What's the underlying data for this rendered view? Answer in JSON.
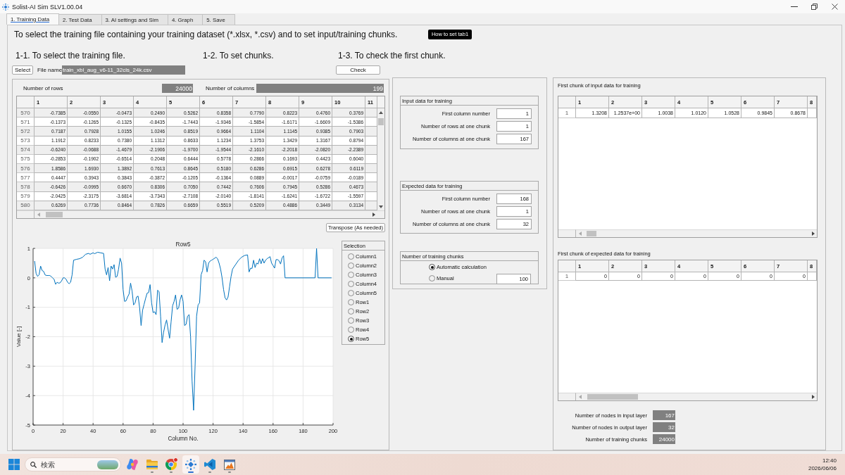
{
  "window": {
    "title": "Solist-AI Sim SLV1.00.04"
  },
  "tabs": [
    {
      "label": "1. Training Data",
      "selected": true
    },
    {
      "label": "2. Test Data",
      "selected": false
    },
    {
      "label": "3. AI settings and Sim",
      "selected": false
    },
    {
      "label": "4. Graph",
      "selected": false
    },
    {
      "label": "5. Save",
      "selected": false
    }
  ],
  "page": {
    "instruction": "To select the training file containing your training dataset (*.xlsx, *.csv) and to set input/training chunks.",
    "help_button": "How to set tab1",
    "section_headings": [
      "1-1. To select the training file.",
      "1-2. To set chunks.",
      "1-3. To check the first chunk."
    ],
    "select_button": "Select",
    "file_label": "File name",
    "file_name": "train_xbl_aug_v6-11_32cls_24k.csv",
    "check_button": "Check"
  },
  "data_panel": {
    "counts": [
      {
        "label": "Number of rows",
        "value": "24000"
      },
      {
        "label": "Number of columns",
        "value": "199"
      }
    ],
    "table": {
      "columns": [
        "1",
        "2",
        "3",
        "4",
        "5",
        "6",
        "7",
        "8",
        "9",
        "10",
        "11"
      ],
      "rows": [
        {
          "header": "570",
          "cells": [
            "-0.7385",
            "-0.0550",
            "-0.0473",
            "0.2490",
            "0.5262",
            "0.8358",
            "0.7790",
            "0.8223",
            "0.4760",
            "0.3769"
          ]
        },
        {
          "header": "571",
          "cells": [
            "-0.1373",
            "-0.1265",
            "-0.1325",
            "-0.8435",
            "-1.7443",
            "-1.9346",
            "-1.5854",
            "-1.6171",
            "-1.6609",
            "-1.5386"
          ]
        },
        {
          "header": "572",
          "cells": [
            "0.7187",
            "0.7928",
            "1.0155",
            "1.0246",
            "0.8519",
            "0.9664",
            "1.1104",
            "1.1145",
            "0.9385",
            "0.7903"
          ]
        },
        {
          "header": "573",
          "cells": [
            "1.1912",
            "0.8233",
            "0.7380",
            "1.1312",
            "0.8633",
            "1.1234",
            "1.3753",
            "1.3429",
            "1.3167",
            "0.8794"
          ]
        },
        {
          "header": "574",
          "cells": [
            "-0.6240",
            "-0.0688",
            "-1.4679",
            "-2.1906",
            "-1.9700",
            "-1.9544",
            "-2.1610",
            "-2.2018",
            "-2.0820",
            "-2.2389"
          ]
        },
        {
          "header": "575",
          "cells": [
            "-0.2853",
            "-0.1902",
            "-0.6514",
            "0.2048",
            "0.6444",
            "0.5778",
            "0.2866",
            "0.1693",
            "0.4423",
            "0.6040"
          ]
        },
        {
          "header": "576",
          "cells": [
            "1.8586",
            "1.6930",
            "1.3892",
            "0.7613",
            "0.8645",
            "0.5180",
            "0.6286",
            "0.6915",
            "0.6278",
            "0.6119"
          ]
        },
        {
          "header": "577",
          "cells": [
            "0.4447",
            "0.3943",
            "0.3843",
            "-0.3872",
            "-0.1205",
            "-0.1364",
            "0.0889",
            "-0.0017",
            "-0.0759",
            "-0.0189"
          ]
        },
        {
          "header": "578",
          "cells": [
            "-0.6426",
            "-0.0995",
            "0.6670",
            "0.8306",
            "0.7050",
            "0.7442",
            "0.7606",
            "0.7945",
            "0.5286",
            "0.4673"
          ]
        },
        {
          "header": "579",
          "cells": [
            "-2.0425",
            "-2.3175",
            "-3.6814",
            "-3.7343",
            "-2.7108",
            "-2.0140",
            "-1.8141",
            "-1.6241",
            "-1.6722",
            "-1.5597"
          ]
        },
        {
          "header": "580",
          "cells": [
            "0.6269",
            "0.7736",
            "0.8464",
            "0.7826",
            "0.6659",
            "0.5519",
            "0.5209",
            "0.4886",
            "0.3449",
            "0.3134"
          ]
        }
      ]
    },
    "transpose_button": "Transpose (As needed)",
    "chart_data": [
      {
        "type": "line",
        "title": "Row5",
        "xlabel": "Column No.",
        "ylabel": "Value [-]",
        "color": "#0072bd",
        "grid": true,
        "xlim": [
          0,
          200
        ],
        "ylim": [
          -5,
          1
        ],
        "xticks": [
          0,
          20,
          40,
          60,
          80,
          100,
          120,
          140,
          160,
          180,
          200
        ],
        "yticks": [
          -5,
          -4,
          -3,
          -2,
          -1,
          0,
          1
        ],
        "x": [
          1,
          2,
          3,
          4,
          5,
          6,
          7,
          8,
          9,
          10,
          11,
          12,
          13,
          14,
          15,
          16,
          17,
          18,
          19,
          20,
          21,
          22,
          23,
          24,
          25,
          26,
          27,
          29,
          31,
          33,
          35,
          37,
          38,
          40,
          41,
          43,
          45,
          47,
          48,
          49,
          50,
          51,
          52,
          53,
          54,
          55,
          56,
          57,
          58,
          59,
          60,
          61,
          62,
          63,
          64,
          65,
          66,
          67,
          68,
          69,
          70,
          71,
          72,
          73,
          74,
          75,
          76,
          77,
          78,
          79,
          80,
          81,
          82,
          83,
          84,
          85,
          86,
          87,
          88,
          89,
          90,
          91,
          92,
          93,
          94,
          95,
          96,
          97,
          98,
          99,
          100,
          101,
          102,
          103,
          104,
          105,
          106,
          107,
          108,
          109,
          110,
          111,
          112,
          113,
          114,
          115,
          116,
          117,
          118,
          119,
          120,
          122,
          123,
          124,
          125,
          126,
          127,
          128,
          129,
          130,
          131,
          132,
          133,
          135,
          137,
          139,
          141,
          143,
          144,
          145,
          146,
          147,
          148,
          149,
          150,
          151,
          152,
          153,
          154,
          155,
          156,
          158,
          159,
          160,
          161,
          162,
          163,
          164,
          165,
          166,
          167,
          168,
          188,
          189,
          190,
          199
        ],
        "values": [
          0.57,
          0.15,
          0.05,
          0.1,
          0.4,
          0.25,
          0.22,
          0.1,
          0.08,
          0.08,
          0.08,
          0.05,
          0,
          -0.05,
          -0.22,
          -0.15,
          -0.18,
          -0.17,
          -0.1,
          0,
          0,
          -0.05,
          -0.15,
          -0.2,
          -0.15,
          0.1,
          0.6,
          0.63,
          0.65,
          0.7,
          0.8,
          0.83,
          0.8,
          0.85,
          0.82,
          0.87,
          0.85,
          0.83,
          0.3,
          0.1,
          0.35,
          -0.1,
          0.4,
          0.3,
          0.45,
          0.02,
          0.05,
          0.3,
          0.67,
          0.5,
          -0.4,
          -0.8,
          -0.78,
          -0.65,
          -0.55,
          -0.18,
          -0.45,
          -0.92,
          -0.85,
          -0.65,
          -0.62,
          -1,
          -1.62,
          -1.1,
          -0.9,
          -0.7,
          -0.52,
          -0.5,
          -0.23,
          -0.85,
          -1.18,
          -1.15,
          -1.25,
          -0.42,
          -0.47,
          -1.3,
          -2.2,
          -1.85,
          -1.6,
          -1.43,
          -1.75,
          -2.05,
          -1.5,
          -0.95,
          -0.8,
          -0.58,
          -1.07,
          -1.03,
          -0.75,
          -0.58,
          -0.8,
          -1.62,
          -1.58,
          -1.3,
          -1.25,
          -2,
          -3.5,
          -4.5,
          -3,
          -1.3,
          -0.92,
          -0.85,
          0.1,
          0.25,
          0.6,
          0.55,
          0.2,
          0.5,
          0.57,
          0.6,
          0.63,
          0.7,
          0.65,
          0.5,
          0.3,
          0,
          -0.4,
          -0.68,
          -0.75,
          -0.65,
          -0.3,
          0.05,
          0.3,
          0.45,
          0.6,
          0.7,
          0.76,
          0.78,
          0.2,
          0.33,
          0.32,
          0.6,
          0.35,
          0.5,
          0.47,
          0.65,
          0.48,
          0.65,
          0.5,
          0.6,
          0.65,
          0.72,
          0.5,
          0.42,
          0.33,
          0.62,
          0.62,
          0.58,
          0.47,
          0.68,
          0.75,
          0,
          0,
          1,
          0,
          0
        ]
      }
    ],
    "selection": {
      "title": "Selection",
      "options": [
        {
          "label": "Column1",
          "selected": false
        },
        {
          "label": "Column2",
          "selected": false
        },
        {
          "label": "Column3",
          "selected": false
        },
        {
          "label": "Column4",
          "selected": false
        },
        {
          "label": "Column5",
          "selected": false
        },
        {
          "label": "Row1",
          "selected": false
        },
        {
          "label": "Row2",
          "selected": false
        },
        {
          "label": "Row3",
          "selected": false
        },
        {
          "label": "Row4",
          "selected": false
        },
        {
          "label": "Row5",
          "selected": true
        }
      ]
    }
  },
  "chunk_settings": {
    "groups": [
      {
        "title": "Input data for training",
        "fields": [
          {
            "label": "First column number",
            "value": "1"
          },
          {
            "label": "Number of rows at one chunk",
            "value": "1"
          },
          {
            "label": "Number of columns at one chunk",
            "value": "167"
          }
        ]
      },
      {
        "title": "Expected data for training",
        "fields": [
          {
            "label": "First column number",
            "value": "168"
          },
          {
            "label": "Number of rows at one chunk",
            "value": "1"
          },
          {
            "label": "Number of columns at one chunk",
            "value": "32"
          }
        ]
      }
    ],
    "training_chunks": {
      "title": "Number of training chunks",
      "options": [
        {
          "label": "Automatic calculation",
          "selected": true
        },
        {
          "label": "Manual",
          "selected": false
        }
      ],
      "manual_value": "100"
    }
  },
  "chunk_preview": {
    "tables": [
      {
        "title": "First chunk of input data for training",
        "columns": [
          "1",
          "2",
          "3",
          "4",
          "5",
          "6",
          "7",
          "8"
        ],
        "rows": [
          {
            "header": "1",
            "cells": [
              "1.3208",
              "1.2537e+00",
              "1.0038",
              "1.0120",
              "1.0528",
              "0.9845",
              "0.8678"
            ]
          }
        ]
      },
      {
        "title": "First chunk of expected data for training",
        "columns": [
          "1",
          "2",
          "3",
          "4",
          "5",
          "6",
          "7",
          "8"
        ],
        "rows": [
          {
            "header": "1",
            "cells": [
              "0",
              "0",
              "0",
              "0",
              "0",
              "0",
              "0"
            ]
          }
        ]
      }
    ],
    "summary": [
      {
        "label": "Number of nodes in input layer",
        "value": "167"
      },
      {
        "label": "Number of nodes in output layer",
        "value": "32"
      },
      {
        "label": "Number of training chunks",
        "value": "24000"
      }
    ]
  },
  "taskbar": {
    "search": {
      "placeholder": "検索"
    },
    "apps": [
      {
        "kind": "swirl",
        "running": false,
        "active": false,
        "badge": false
      },
      {
        "kind": "folder",
        "running": true,
        "active": false,
        "badge": false
      },
      {
        "kind": "browser",
        "running": true,
        "active": false,
        "badge": true
      },
      {
        "kind": "sparkle",
        "running": true,
        "active": true,
        "badge": false
      },
      {
        "kind": "editor",
        "running": true,
        "active": false,
        "badge": false
      },
      {
        "kind": "plot",
        "running": true,
        "active": false,
        "badge": false
      }
    ],
    "time": "12:40",
    "date": "2026/06/06"
  }
}
